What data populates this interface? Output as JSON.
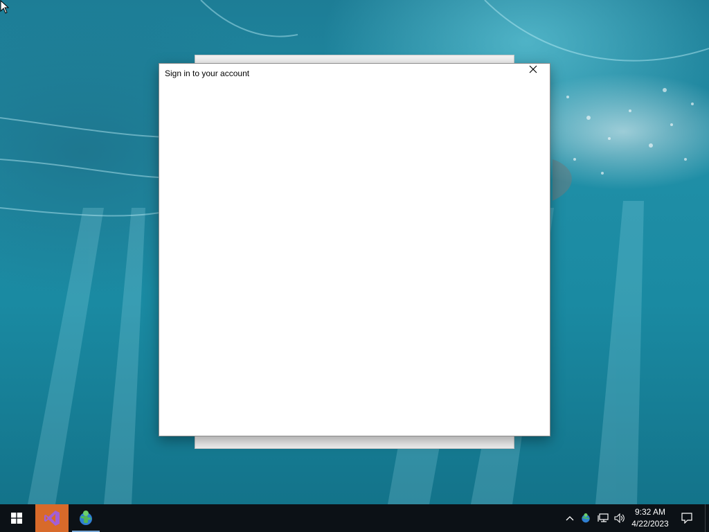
{
  "desktop": {
    "wallpaper": "underwater-ocean-wallpaper"
  },
  "dialog": {
    "title": "Sign in to your account",
    "close_icon": "close-icon"
  },
  "taskbar": {
    "start_icon": "windows-start-icon",
    "pinned_apps": [
      {
        "icon": "visual-studio-icon",
        "accent": "#d86a2a"
      },
      {
        "icon": "app-user-globe-icon",
        "active": true
      }
    ],
    "tray": {
      "icons": [
        "chevron-up-icon",
        "app-user-globe-icon",
        "network-icon",
        "volume-icon"
      ],
      "time": "9:32 AM",
      "date": "4/22/2023",
      "notification_icon": "action-center-icon"
    }
  }
}
